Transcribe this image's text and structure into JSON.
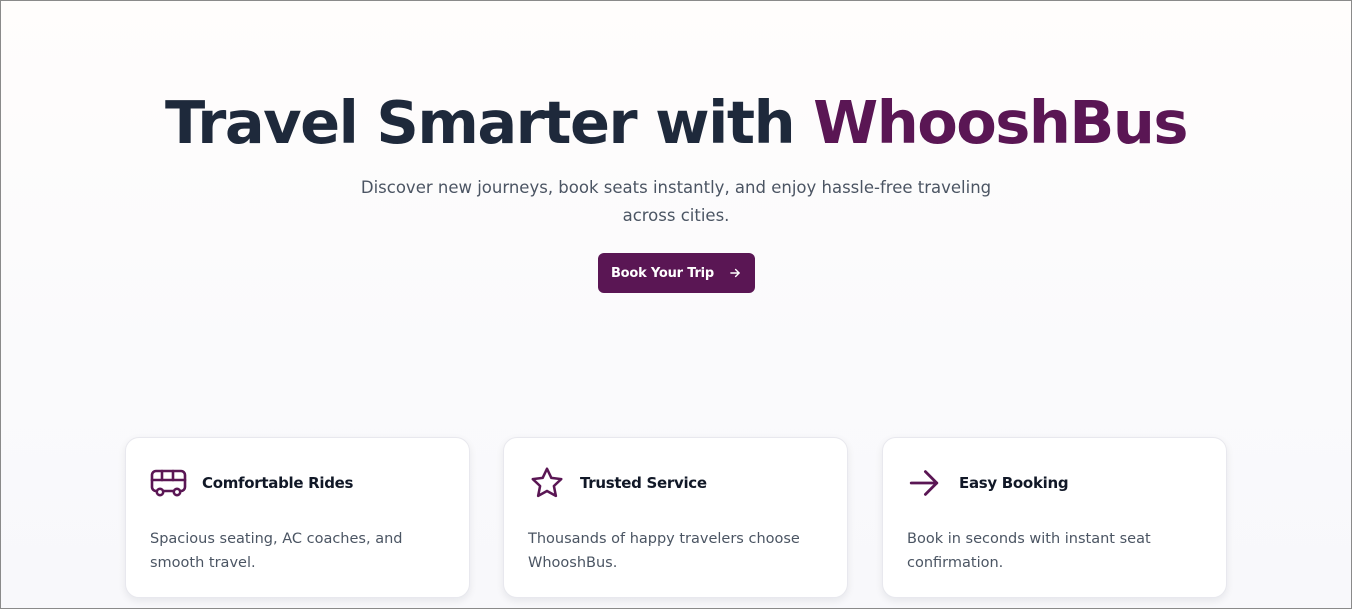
{
  "hero": {
    "title_prefix": "Travel Smarter with ",
    "title_brand": "WhooshBus",
    "subtitle": "Discover new journeys, book seats instantly, and enjoy hassle-free traveling across cities.",
    "cta_label": "Book Your Trip",
    "cta_icon": "arrow-right-icon"
  },
  "features": [
    {
      "icon": "bus-icon",
      "title": "Comfortable Rides",
      "text": "Spacious seating, AC coaches, and smooth travel."
    },
    {
      "icon": "star-icon",
      "title": "Trusted Service",
      "text": "Thousands of happy travelers choose WhooshBus."
    },
    {
      "icon": "arrow-right-icon",
      "title": "Easy Booking",
      "text": "Book in seconds with instant seat confirmation."
    }
  ],
  "colors": {
    "brand": "#5a1654",
    "heading": "#1e293b",
    "body_text": "#4b5563"
  }
}
